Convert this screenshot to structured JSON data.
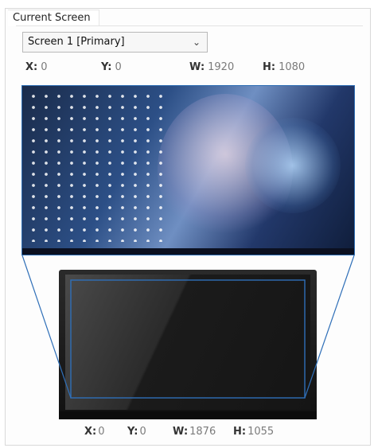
{
  "group": {
    "title": "Current Screen"
  },
  "screen_select": {
    "value": "Screen 1 [Primary]",
    "icon": "chevron-down-icon"
  },
  "screen_coords": {
    "x_label": "X:",
    "x": "0",
    "y_label": "Y:",
    "y": "0",
    "w_label": "W:",
    "w": "1920",
    "h_label": "H:",
    "h": "1080"
  },
  "mapping_coords": {
    "x_label": "X:",
    "x": "0",
    "y_label": "Y:",
    "y": "0",
    "w_label": "W:",
    "w": "1876",
    "h_label": "H:",
    "h": "1055"
  },
  "colors": {
    "accent": "#2d6db3",
    "connector": "#2f6fb8",
    "panel_border": "#d9d9d9"
  }
}
